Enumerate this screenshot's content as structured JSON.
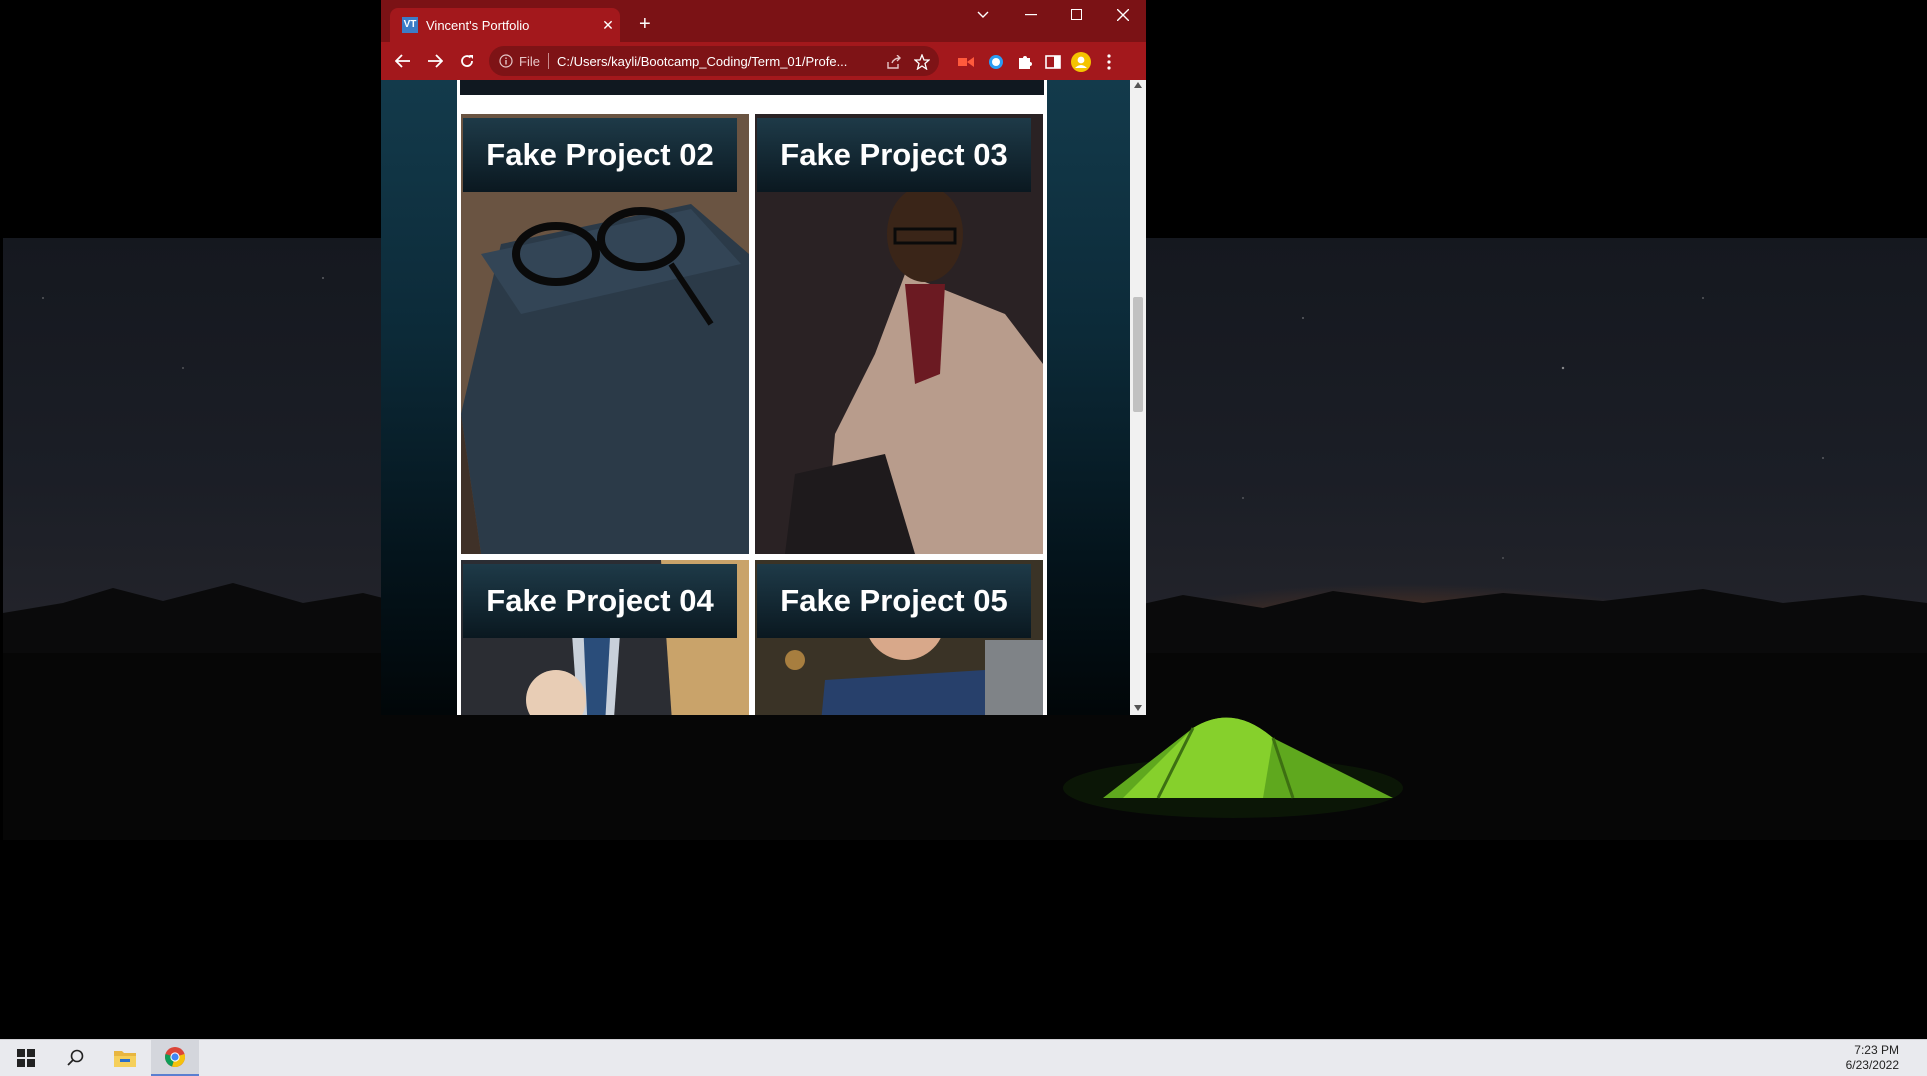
{
  "browser": {
    "tab": {
      "favicon_text": "VT",
      "title": "Vincent's Portfolio"
    },
    "address": {
      "scheme_label": "File",
      "url": "C:/Users/kayli/Bootcamp_Coding/Term_01/Profe..."
    },
    "colors": {
      "frame": "#7b1215",
      "toolbar": "#a3181c"
    }
  },
  "page": {
    "projects": [
      {
        "title": "Fake Project 02"
      },
      {
        "title": "Fake Project 03"
      },
      {
        "title": "Fake Project 04"
      },
      {
        "title": "Fake Project 05"
      }
    ]
  },
  "taskbar": {
    "time": "7:23 PM",
    "date": "6/23/2022",
    "apps": [
      "start-icon",
      "search-icon",
      "file-explorer-icon",
      "chrome-icon"
    ]
  }
}
